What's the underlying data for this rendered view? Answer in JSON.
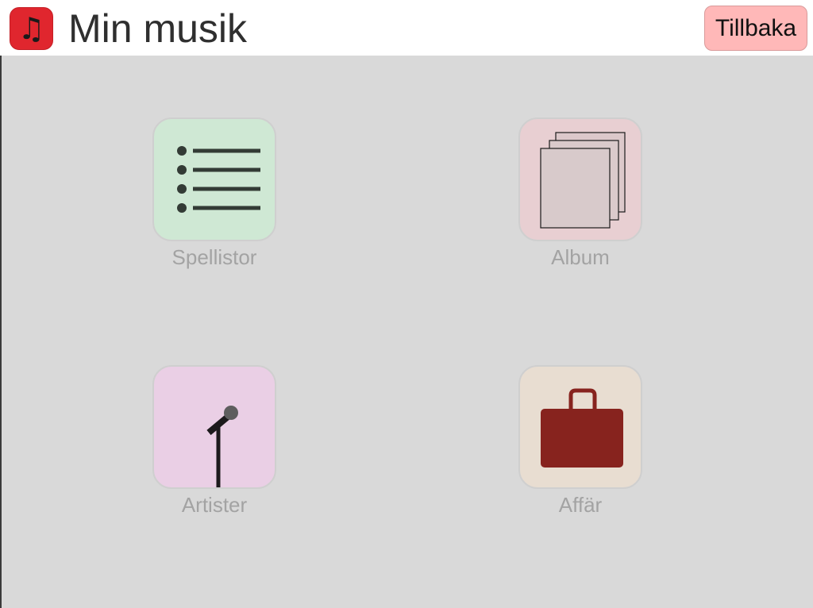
{
  "header": {
    "app_icon_glyph": "♫",
    "app_icon_name": "music-note-icon",
    "title": "Min musik",
    "back_label": "Tillbaka"
  },
  "tiles": [
    {
      "label": "Spellistor",
      "icon": "list-icon",
      "color": "#cfe8d4"
    },
    {
      "label": "Album",
      "icon": "album-stack-icon",
      "color": "#e8cfd2"
    },
    {
      "label": "Artister",
      "icon": "microphone-icon",
      "color": "#eacfe5"
    },
    {
      "label": "Affär",
      "icon": "shopping-bag-icon",
      "color": "#e8ddd1"
    }
  ],
  "colors": {
    "app_icon": "#e0262e",
    "back_button": "#ffb8b8",
    "background": "#d9d9d9",
    "bag": "#87231e"
  }
}
